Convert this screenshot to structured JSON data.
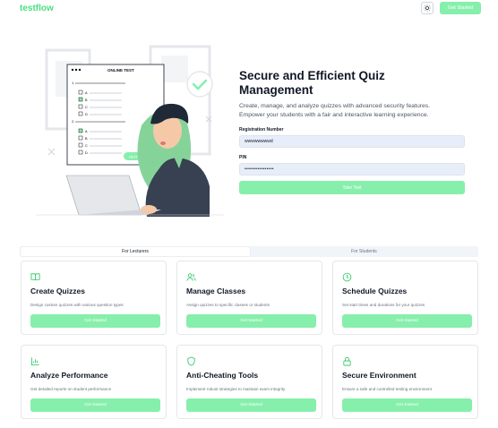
{
  "header": {
    "logo": "testflow",
    "get_started": "Get Started",
    "theme_icon": "sun-icon"
  },
  "illustration": {
    "test_title": "ONLINE TEST",
    "q1": "1.",
    "q2": "2.",
    "options": [
      "A",
      "B",
      "C",
      "D"
    ],
    "next": "NEXT"
  },
  "hero": {
    "title_line1": "Secure and Efficient Quiz",
    "title_line2": "Management",
    "subtitle_line1": "Create, manage, and analyze quizzes with advanced security features.",
    "subtitle_line2": "Empower your students with a fair and interactive learning experience.",
    "reg_label": "Registration Number",
    "reg_value": "wwwwwwwwd",
    "pin_label": "PIN",
    "pin_value": "••••••••••••••••",
    "take_test": "Take Test"
  },
  "tabs": {
    "lecturers": "For Lecturers",
    "students": "For Students"
  },
  "cards": [
    {
      "title": "Create Quizzes",
      "desc": "Design custom quizzes with various question types",
      "button": "Get Started",
      "icon": "book-icon"
    },
    {
      "title": "Manage Classes",
      "desc": "Assign quizzes to specific classes or students",
      "button": "Get Started",
      "icon": "users-icon"
    },
    {
      "title": "Schedule Quizzes",
      "desc": "Set start times and durations for your quizzes",
      "button": "Get Started",
      "icon": "clock-icon"
    },
    {
      "title": "Analyze Performance",
      "desc": "Get detailed reports on student performance",
      "button": "Get Started",
      "icon": "bar-chart-icon"
    },
    {
      "title": "Anti-Cheating Tools",
      "desc": "Implement robust strategies to maintain exam integrity",
      "button": "Get Started",
      "icon": "shield-icon"
    },
    {
      "title": "Secure Environment",
      "desc": "Ensure a safe and controlled testing environment",
      "button": "Get Started",
      "icon": "lock-icon"
    }
  ],
  "colors": {
    "accent": "#4ade80",
    "button": "#86efac",
    "input_bg": "#e8eef9",
    "person_hijab": "#86d39a"
  }
}
